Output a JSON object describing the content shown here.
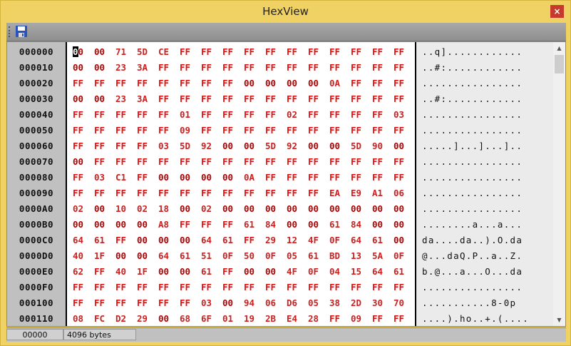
{
  "window": {
    "title": "HexView",
    "close_label": "×"
  },
  "toolbar": {
    "save_icon": "save-icon"
  },
  "rows": [
    {
      "offset": "000000",
      "bytes": [
        "00",
        "00",
        "71",
        "5D",
        "CE",
        "FF",
        "FF",
        "FF",
        "FF",
        "FF",
        "FF",
        "FF",
        "FF",
        "FF",
        "FF",
        "FF"
      ],
      "ascii": "..q]............"
    },
    {
      "offset": "000010",
      "bytes": [
        "00",
        "00",
        "23",
        "3A",
        "FF",
        "FF",
        "FF",
        "FF",
        "FF",
        "FF",
        "FF",
        "FF",
        "FF",
        "FF",
        "FF",
        "FF"
      ],
      "ascii": "..#:............"
    },
    {
      "offset": "000020",
      "bytes": [
        "FF",
        "FF",
        "FF",
        "FF",
        "FF",
        "FF",
        "FF",
        "FF",
        "00",
        "00",
        "00",
        "00",
        "0A",
        "FF",
        "FF",
        "FF"
      ],
      "ascii": "................"
    },
    {
      "offset": "000030",
      "bytes": [
        "00",
        "00",
        "23",
        "3A",
        "FF",
        "FF",
        "FF",
        "FF",
        "FF",
        "FF",
        "FF",
        "FF",
        "FF",
        "FF",
        "FF",
        "FF"
      ],
      "ascii": "..#:............"
    },
    {
      "offset": "000040",
      "bytes": [
        "FF",
        "FF",
        "FF",
        "FF",
        "FF",
        "01",
        "FF",
        "FF",
        "FF",
        "FF",
        "02",
        "FF",
        "FF",
        "FF",
        "FF",
        "03"
      ],
      "ascii": "................"
    },
    {
      "offset": "000050",
      "bytes": [
        "FF",
        "FF",
        "FF",
        "FF",
        "FF",
        "09",
        "FF",
        "FF",
        "FF",
        "FF",
        "FF",
        "FF",
        "FF",
        "FF",
        "FF",
        "FF"
      ],
      "ascii": "................"
    },
    {
      "offset": "000060",
      "bytes": [
        "FF",
        "FF",
        "FF",
        "FF",
        "03",
        "5D",
        "92",
        "00",
        "00",
        "5D",
        "92",
        "00",
        "00",
        "5D",
        "90",
        "00"
      ],
      "ascii": ".....]...]...].."
    },
    {
      "offset": "000070",
      "bytes": [
        "00",
        "FF",
        "FF",
        "FF",
        "FF",
        "FF",
        "FF",
        "FF",
        "FF",
        "FF",
        "FF",
        "FF",
        "FF",
        "FF",
        "FF",
        "FF"
      ],
      "ascii": "................"
    },
    {
      "offset": "000080",
      "bytes": [
        "FF",
        "03",
        "C1",
        "FF",
        "00",
        "00",
        "00",
        "00",
        "0A",
        "FF",
        "FF",
        "FF",
        "FF",
        "FF",
        "FF",
        "FF"
      ],
      "ascii": "................"
    },
    {
      "offset": "000090",
      "bytes": [
        "FF",
        "FF",
        "FF",
        "FF",
        "FF",
        "FF",
        "FF",
        "FF",
        "FF",
        "FF",
        "FF",
        "FF",
        "EA",
        "E9",
        "A1",
        "06"
      ],
      "ascii": "................"
    },
    {
      "offset": "0000A0",
      "bytes": [
        "02",
        "00",
        "10",
        "02",
        "18",
        "00",
        "02",
        "00",
        "00",
        "00",
        "00",
        "00",
        "00",
        "00",
        "00",
        "00"
      ],
      "ascii": "................"
    },
    {
      "offset": "0000B0",
      "bytes": [
        "00",
        "00",
        "00",
        "00",
        "A8",
        "FF",
        "FF",
        "FF",
        "61",
        "84",
        "00",
        "00",
        "61",
        "84",
        "00",
        "00"
      ],
      "ascii": "........a...a..."
    },
    {
      "offset": "0000C0",
      "bytes": [
        "64",
        "61",
        "FF",
        "00",
        "00",
        "00",
        "64",
        "61",
        "FF",
        "29",
        "12",
        "4F",
        "0F",
        "64",
        "61",
        "00"
      ],
      "ascii": "da....da..).O.da"
    },
    {
      "offset": "0000D0",
      "bytes": [
        "40",
        "1F",
        "00",
        "00",
        "64",
        "61",
        "51",
        "0F",
        "50",
        "0F",
        "05",
        "61",
        "BD",
        "13",
        "5A",
        "0F"
      ],
      "ascii": "@...daQ.P..a..Z."
    },
    {
      "offset": "0000E0",
      "bytes": [
        "62",
        "FF",
        "40",
        "1F",
        "00",
        "00",
        "61",
        "FF",
        "00",
        "00",
        "4F",
        "0F",
        "04",
        "15",
        "64",
        "61"
      ],
      "ascii": "b.@...a...O...da"
    },
    {
      "offset": "0000F0",
      "bytes": [
        "FF",
        "FF",
        "FF",
        "FF",
        "FF",
        "FF",
        "FF",
        "FF",
        "FF",
        "FF",
        "FF",
        "FF",
        "FF",
        "FF",
        "FF",
        "FF"
      ],
      "ascii": "................"
    },
    {
      "offset": "000100",
      "bytes": [
        "FF",
        "FF",
        "FF",
        "FF",
        "FF",
        "FF",
        "03",
        "00",
        "94",
        "06",
        "D6",
        "05",
        "38",
        "2D",
        "30",
        "70"
      ],
      "ascii": "...........8-0p"
    },
    {
      "offset": "000110",
      "bytes": [
        "08",
        "FC",
        "D2",
        "29",
        "00",
        "68",
        "6F",
        "01",
        "19",
        "2B",
        "E4",
        "28",
        "FF",
        "09",
        "FF",
        "FF"
      ],
      "ascii": "....).ho..+.(...."
    }
  ],
  "status": {
    "position": "00000",
    "size": "4096 bytes"
  }
}
